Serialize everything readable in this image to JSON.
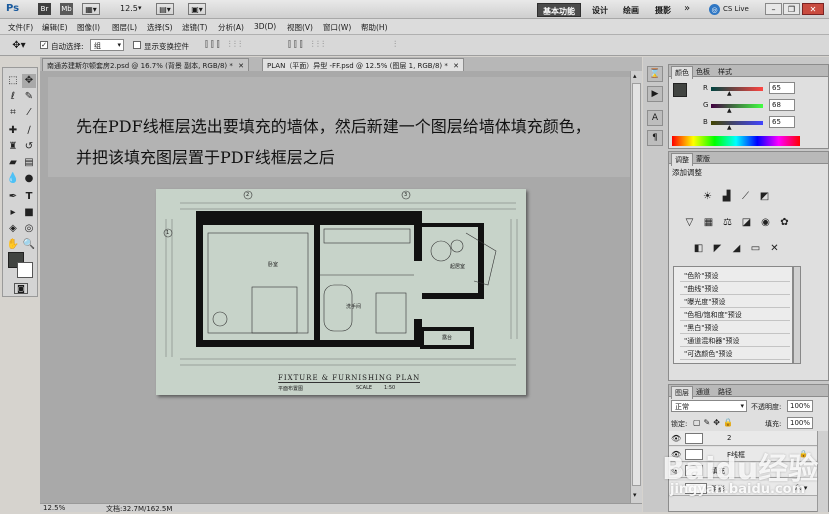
{
  "app": {
    "logo": "Ps",
    "zoom": "12.5",
    "workspaces": [
      "基本功能",
      "设计",
      "绘画",
      "摄影"
    ],
    "more": "»",
    "cs_live": "CS Live"
  },
  "menu": [
    "文件(F)",
    "编辑(E)",
    "图像(I)",
    "图层(L)",
    "选择(S)",
    "滤镜(T)",
    "分析(A)",
    "3D(D)",
    "视图(V)",
    "窗口(W)",
    "帮助(H)"
  ],
  "options": {
    "auto_select_label": "自动选择:",
    "auto_select_value": "组",
    "show_transform_label": "显示变换控件"
  },
  "tabs": [
    {
      "label": "南通苏建斯尔顿套房2.psd @ 16.7% (背景 副本, RGB/8) *"
    },
    {
      "label": "PLAN（平面）异型 -FF.psd @ 12.5% (图层 1, RGB/8) *"
    }
  ],
  "canvas": {
    "instruction_line1": "先在PDF线框层选出要填充的墙体，然后新建一个图层给墙体填充颜色，",
    "instruction_line2": "并把该填充图层置于PDF线框层之后",
    "plan_title": "FIXTURE & FURNISHING PLAN",
    "plan_subtitle": "平面布置图",
    "plan_scale_label": "SCALE",
    "plan_scale_value": "1:50",
    "plan_room_labels": [
      "卧室",
      "洗手间",
      "起居室",
      "露台"
    ],
    "plan_marks": [
      "1",
      "2",
      "3"
    ]
  },
  "status": {
    "zoom": "12.5%",
    "doc": "文档:32.7M/162.5M"
  },
  "color_panel": {
    "tabs": [
      "颜色",
      "色板",
      "样式"
    ],
    "r_label": "R",
    "g_label": "G",
    "b_label": "B",
    "r": 65,
    "g": 68,
    "b": 65,
    "fg_color": "#414441"
  },
  "adjust_panel": {
    "tabs": [
      "调整",
      "蒙版"
    ],
    "title": "添加调整",
    "presets": [
      "\"色阶\"预设",
      "\"曲线\"预设",
      "\"曝光度\"预设",
      "\"色相/饱和度\"预设",
      "\"黑白\"预设",
      "\"通道混和器\"预设",
      "\"可选颜色\"预设"
    ]
  },
  "layers_panel": {
    "tabs": [
      "图层",
      "通道",
      "路径"
    ],
    "blend_mode": "正常",
    "opacity_label": "不透明度:",
    "opacity": "100%",
    "lock_label": "锁定:",
    "fill_label": "填充:",
    "fill": "100%",
    "layers": [
      {
        "name": "2"
      },
      {
        "name": "F线框"
      },
      {
        "name": "填充"
      },
      {
        "name": "阴影"
      }
    ]
  },
  "watermark": {
    "brand": "Baidu经验",
    "url": "jingyan.baidu.com"
  }
}
